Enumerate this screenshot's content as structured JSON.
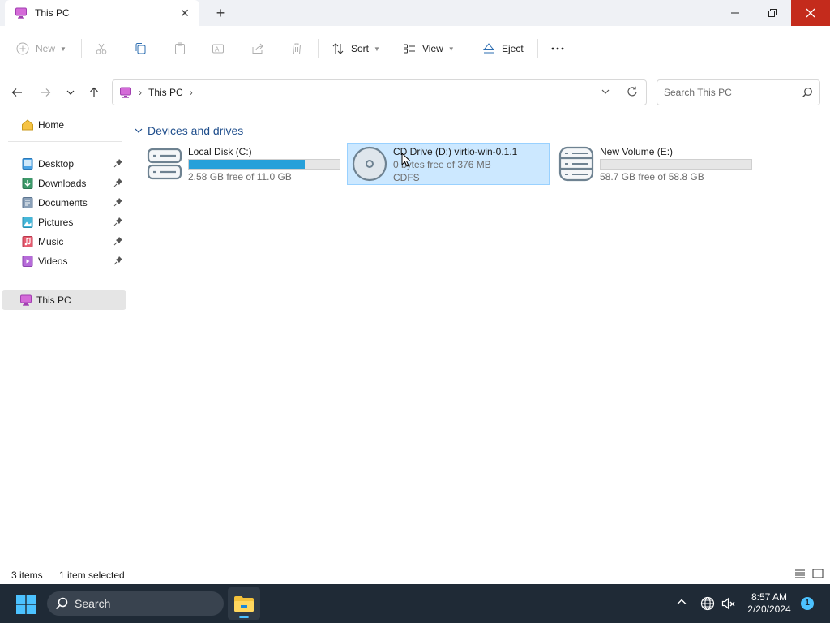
{
  "window": {
    "tab_title": "This PC",
    "new_tab_symbol": "+",
    "close_tab_symbol": "✕"
  },
  "commands": {
    "new": "New",
    "sort": "Sort",
    "view": "View",
    "eject": "Eject"
  },
  "address": {
    "breadcrumb": "This PC",
    "search_placeholder": "Search This PC"
  },
  "sidebar": {
    "home": "Home",
    "pinned": [
      {
        "label": "Desktop",
        "icon": "desktop-icon"
      },
      {
        "label": "Downloads",
        "icon": "downloads-icon"
      },
      {
        "label": "Documents",
        "icon": "documents-icon"
      },
      {
        "label": "Pictures",
        "icon": "pictures-icon"
      },
      {
        "label": "Music",
        "icon": "music-icon"
      },
      {
        "label": "Videos",
        "icon": "videos-icon"
      }
    ],
    "this_pc": "This PC"
  },
  "main": {
    "group_title": "Devices and drives",
    "drives": [
      {
        "name": "Local Disk (C:)",
        "free": "2.58 GB free of 11.0 GB",
        "used_fraction": 0.77,
        "icon": "hard-drive-icon"
      },
      {
        "name": "CD Drive (D:) virtio-win-0.1.1",
        "free": "0 bytes free of 376 MB",
        "filesystem": "CDFS",
        "icon": "cd-drive-icon",
        "selected": true
      },
      {
        "name": "New Volume (E:)",
        "free": "58.7 GB free of 58.8 GB",
        "used_fraction": 0.0,
        "icon": "hard-drive-icon"
      }
    ]
  },
  "status": {
    "item_count": "3 items",
    "selection": "1 item selected"
  },
  "taskbar": {
    "search_label": "Search",
    "time": "8:57 AM",
    "date": "2/20/2024",
    "notification_count": "1"
  },
  "colors": {
    "accent": "#26a0da",
    "selection_bg": "#cce8ff",
    "close_red": "#c42b1c",
    "taskbar_bg": "#1f2a36"
  }
}
